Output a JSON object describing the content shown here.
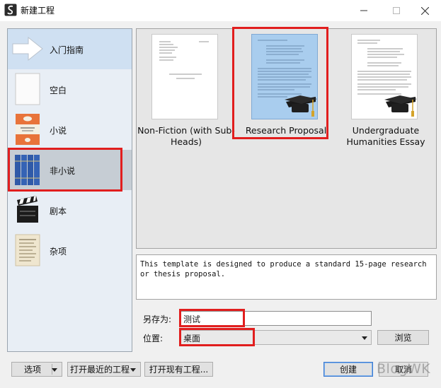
{
  "window": {
    "title": "新建工程"
  },
  "sidebar": {
    "items": [
      {
        "label": "入门指南",
        "icon": "arrow-guide-icon"
      },
      {
        "label": "空白",
        "icon": "blank-page-icon"
      },
      {
        "label": "小说",
        "icon": "novel-book-icon"
      },
      {
        "label": "非小说",
        "icon": "nonfiction-books-icon"
      },
      {
        "label": "剧本",
        "icon": "clapperboard-icon"
      },
      {
        "label": "杂项",
        "icon": "misc-paper-icon"
      }
    ],
    "selected": "非小说"
  },
  "templates": [
    {
      "label": "Non-Fiction (with Sub-Heads)"
    },
    {
      "label": "Research Proposal",
      "selected": true
    },
    {
      "label": "Undergraduate Humanities Essay"
    }
  ],
  "description": "This template is designed to produce a standard 15-page research or thesis proposal.",
  "form": {
    "save_as_label": "另存为:",
    "save_as_value": "测试",
    "location_label": "位置:",
    "location_value": "桌面",
    "browse_label": "浏览"
  },
  "footer": {
    "options_label": "选项",
    "open_recent_label": "打开最近的工程",
    "open_existing_label": "打开现有工程...",
    "create_label": "创建",
    "cancel_label": "取消"
  },
  "watermark": "BlogWK",
  "colors": {
    "highlight_box": "#e11e1e",
    "selected_template_bg": "#a9cdee",
    "selected_category_bg": "#c6cdd4"
  }
}
